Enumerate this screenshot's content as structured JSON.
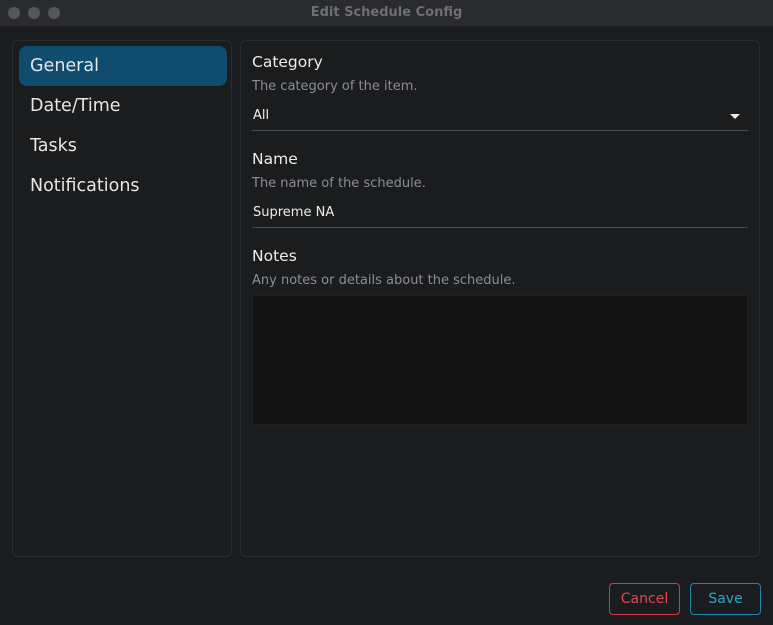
{
  "window": {
    "title": "Edit Schedule Config"
  },
  "sidebar": {
    "items": [
      {
        "label": "General",
        "active": true
      },
      {
        "label": "Date/Time",
        "active": false
      },
      {
        "label": "Tasks",
        "active": false
      },
      {
        "label": "Notifications",
        "active": false
      }
    ]
  },
  "form": {
    "category": {
      "label": "Category",
      "description": "The category of the item.",
      "value": "All",
      "icon": "chevron-down-icon"
    },
    "name": {
      "label": "Name",
      "description": "The name of the schedule.",
      "value": "Supreme NA"
    },
    "notes": {
      "label": "Notes",
      "description": "Any notes or details about the schedule.",
      "value": ""
    }
  },
  "actions": {
    "cancel_label": "Cancel",
    "save_label": "Save"
  },
  "colors": {
    "accent_active": "#0f4c6d",
    "cancel": "#d23a3f",
    "save": "#1a8aa6"
  }
}
